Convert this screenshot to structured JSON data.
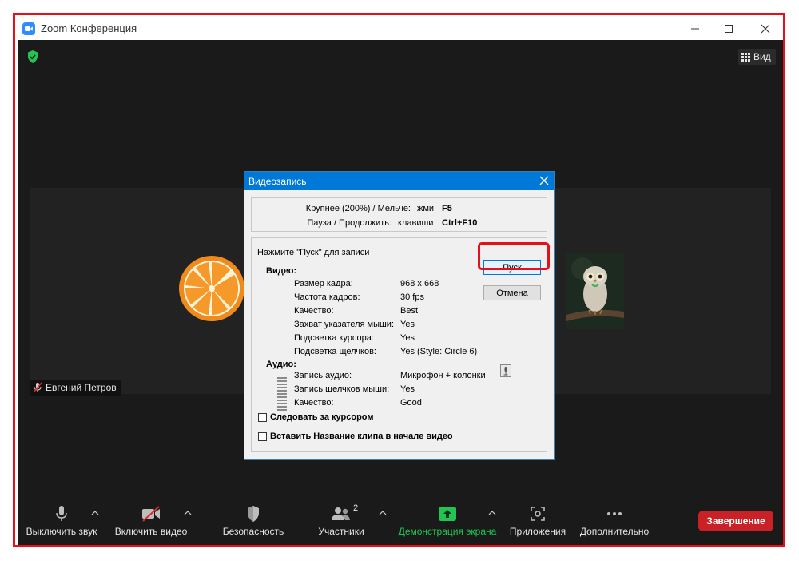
{
  "window": {
    "title": "Zoom Конференция"
  },
  "top": {
    "view_label": "Вид"
  },
  "video": {
    "participant_name": "Евгений Петров"
  },
  "dialog": {
    "title": "Видеозапись",
    "hotkeys": {
      "row1_label": "Крупнее (200%) / Мельче:",
      "row1_prefix": "жми",
      "row1_key": "F5",
      "row2_label": "Пауза / Продолжить:",
      "row2_prefix": "клавиши",
      "row2_key": "Ctrl+F10"
    },
    "instruction": "Нажмите \"Пуск\" для записи",
    "start_label": "Пуск",
    "cancel_label": "Отмена",
    "video_header": "Видео:",
    "video_rows": [
      {
        "label": "Размер кадра:",
        "value": "968 x 668"
      },
      {
        "label": "Частота кадров:",
        "value": "30 fps"
      },
      {
        "label": "Качество:",
        "value": "Best"
      },
      {
        "label": "Захват указателя мыши:",
        "value": "Yes"
      },
      {
        "label": "Подсветка курсора:",
        "value": "Yes"
      },
      {
        "label": "Подсветка щелчков:",
        "value": "Yes (Style: Circle 6)"
      }
    ],
    "audio_header": "Аудио:",
    "audio_rows": [
      {
        "label": "Запись аудио:",
        "value": "Микрофон + колонки"
      },
      {
        "label": "Запись щелчков мыши:",
        "value": "Yes"
      },
      {
        "label": "Качество:",
        "value": "Good"
      }
    ],
    "follow_cursor_label": "Следовать за курсором",
    "insert_title_label": "Вставить Название клипа в начале видео"
  },
  "toolbar": {
    "mute_label": "Выключить звук",
    "video_label": "Включить видео",
    "security_label": "Безопасность",
    "participants_label": "Участники",
    "participants_count": "2",
    "share_label": "Демонстрация экрана",
    "apps_label": "Приложения",
    "more_label": "Дополнительно",
    "end_label": "Завершение"
  },
  "colors": {
    "accent_green": "#23c552",
    "end_red": "#c92126",
    "highlight_red": "#e5101a",
    "dialog_title_blue": "#0078d7"
  }
}
